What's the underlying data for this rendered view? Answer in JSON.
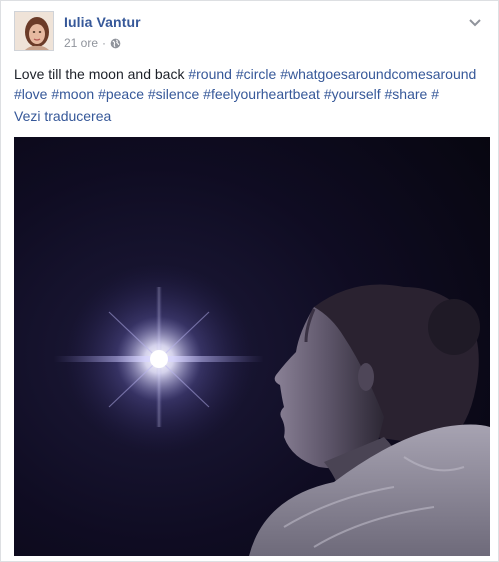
{
  "post": {
    "author": "Iulia Vantur",
    "time": "21 ore",
    "separator": "·",
    "audience_icon": "globe-icon",
    "text_intro": "Love till the moon and back",
    "hashtags": [
      "#round",
      "#circle",
      "#whatgoesaroundcomesaround",
      "#love",
      "#moon",
      "#peace",
      "#silence",
      "#feelyourheartbeat",
      "#yourself",
      "#share",
      "#"
    ],
    "translate_link": "Vezi traducerea",
    "menu_icon": "chevron-down-icon"
  },
  "colors": {
    "link": "#365899",
    "meta": "#90949c",
    "text": "#1d2129",
    "border": "#dddfe2"
  }
}
